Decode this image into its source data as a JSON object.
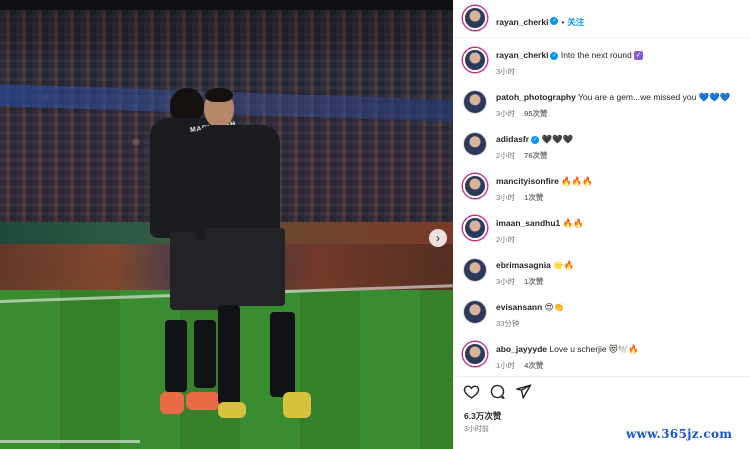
{
  "header": {
    "username": "rayan_cherki",
    "separator": "•",
    "follow_label": "关注"
  },
  "photo": {
    "shirt_name": "MARMOUSH"
  },
  "caption": {
    "username": "rayan_cherki",
    "text": "Into the next round",
    "time": "3小时"
  },
  "comments": [
    {
      "username": "patoh_photography",
      "text": "You are a gem...we missed you 💙💙💙",
      "time": "3小时",
      "likes": "95次赞"
    },
    {
      "username": "adidasfr",
      "text": "🖤🖤🖤",
      "time": "2小时",
      "likes": "76次赞"
    },
    {
      "username": "mancityisonfire",
      "text": "🔥🔥🔥",
      "time": "3小时",
      "likes": "1次赞"
    },
    {
      "username": "imaan_sandhu1",
      "text": "🔥🔥",
      "time": "2小时",
      "likes": ""
    },
    {
      "username": "ebrimasagnia",
      "text": "🌟🔥",
      "time": "3小时",
      "likes": "1次赞"
    },
    {
      "username": "evisansann",
      "text": "😍👏",
      "time": "33分钟",
      "likes": ""
    },
    {
      "username": "abo_jayyyde",
      "text": "Love u scherjie 😻🕊️🔥",
      "time": "1小时",
      "likes": "4次赞"
    }
  ],
  "actions": {
    "likes_label": "6.3万次赞",
    "post_time": "3小时前"
  },
  "watermark": "www.365jz.com",
  "icons": {
    "like": "heart-icon",
    "comment": "comment-bubble-icon",
    "share": "paper-plane-icon",
    "verified": "verified-badge-icon",
    "next": "chevron-right-icon"
  },
  "colors": {
    "accent": "#0095f6",
    "muted": "#737373",
    "text": "#262626",
    "watermark": "#1a55c9"
  }
}
